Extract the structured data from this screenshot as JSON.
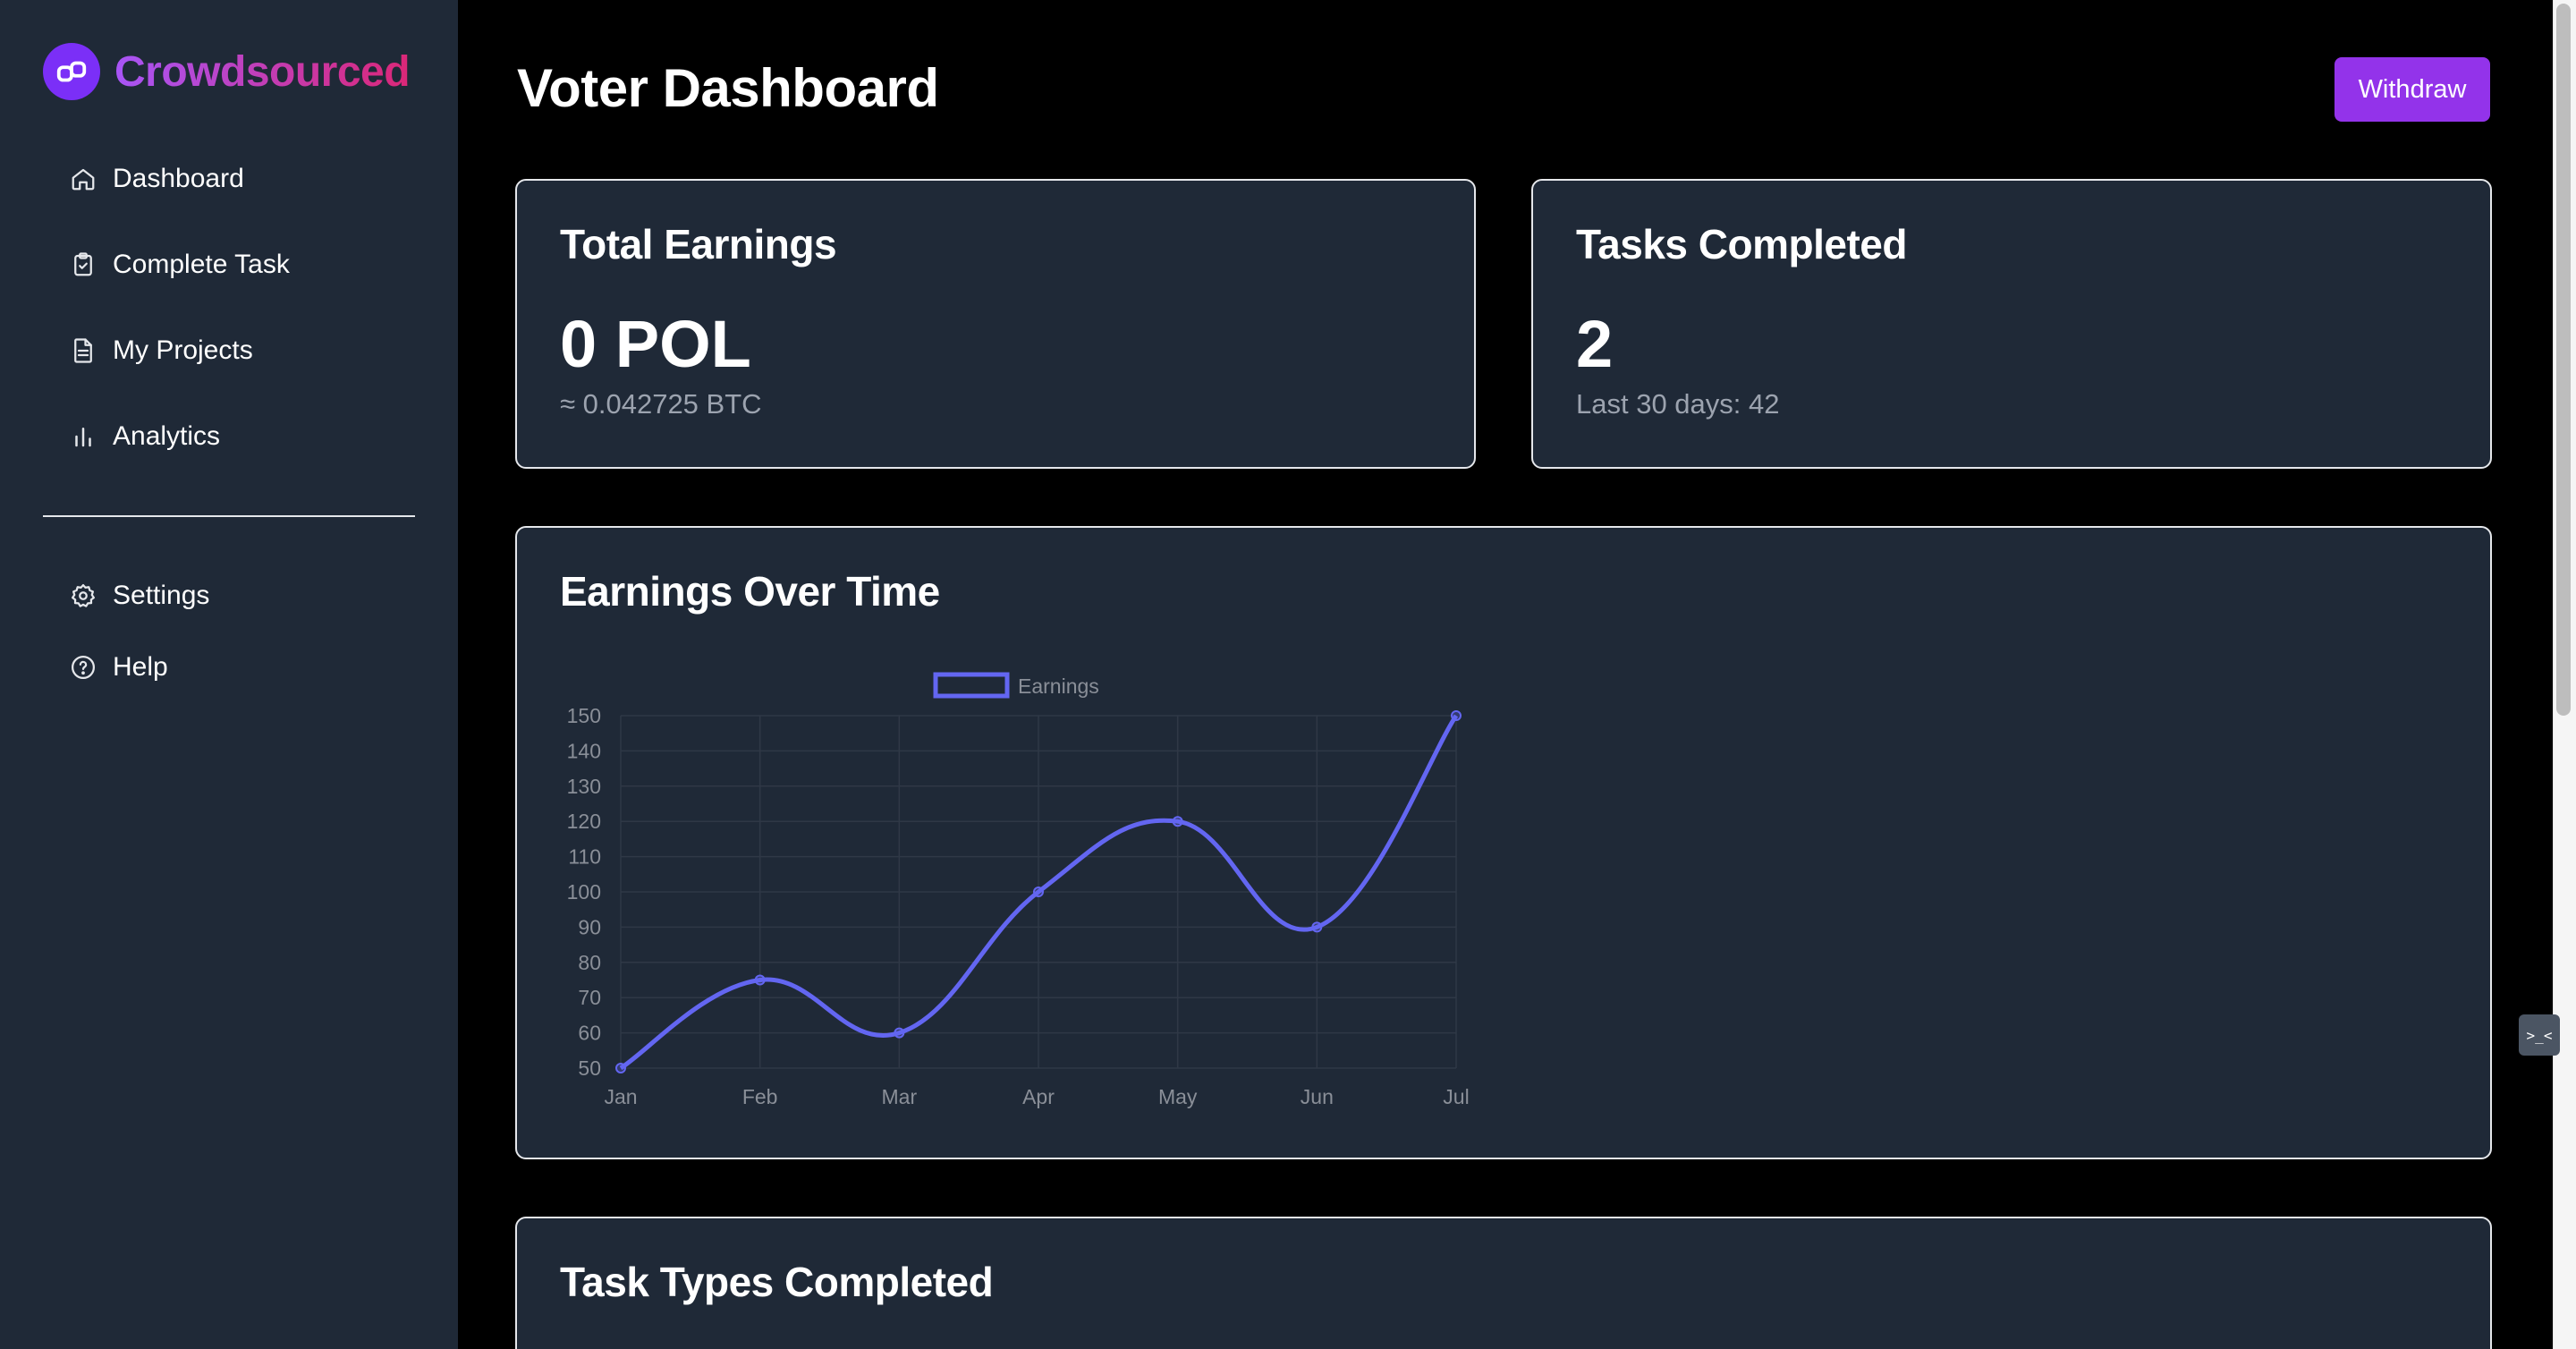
{
  "brand": {
    "name": "Crowdsourced",
    "logo_icon": "link-icon",
    "color_from": "#a855f7",
    "color_to": "#db2777"
  },
  "sidebar": {
    "items": [
      {
        "label": "Dashboard",
        "icon": "home-icon"
      },
      {
        "label": "Complete Task",
        "icon": "clipboard-icon"
      },
      {
        "label": "My Projects",
        "icon": "document-icon"
      },
      {
        "label": "Analytics",
        "icon": "bar-chart-icon"
      }
    ],
    "secondary": [
      {
        "label": "Settings",
        "icon": "gear-icon"
      },
      {
        "label": "Help",
        "icon": "help-circle-icon"
      }
    ]
  },
  "header": {
    "title": "Voter Dashboard",
    "withdraw_label": "Withdraw",
    "accent": "#9333ea"
  },
  "earnings_card": {
    "title": "Total Earnings",
    "value": "0 POL",
    "sub": "≈ 0.042725 BTC"
  },
  "tasks_card": {
    "title": "Tasks Completed",
    "value": "2",
    "sub": "Last 30 days: 42"
  },
  "chart_card": {
    "title": "Earnings Over Time"
  },
  "types_card": {
    "title": "Task Types Completed"
  },
  "float_tab": {
    "label": ">_<"
  },
  "chart_data": {
    "type": "line",
    "categories": [
      "Jan",
      "Feb",
      "Mar",
      "Apr",
      "May",
      "Jun",
      "Jul"
    ],
    "series": [
      {
        "name": "Earnings",
        "values": [
          50,
          75,
          60,
          100,
          120,
          90,
          150
        ],
        "color": "#6366f1"
      }
    ],
    "ylim": [
      50,
      150
    ],
    "yticks": [
      50,
      60,
      70,
      80,
      90,
      100,
      110,
      120,
      130,
      140,
      150
    ],
    "grid": true,
    "legend": "top-center"
  }
}
